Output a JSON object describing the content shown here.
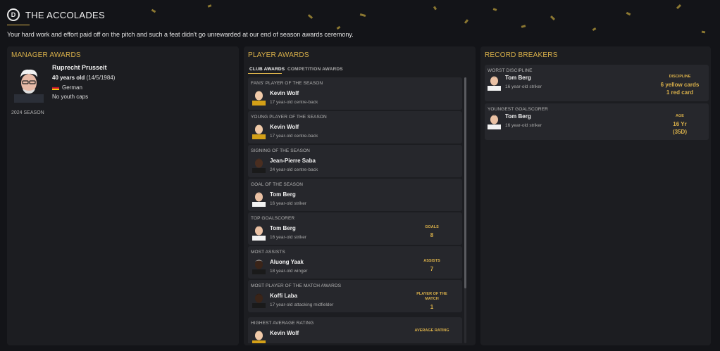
{
  "header": {
    "title": "THE ACCOLADES",
    "logo_letter": "D",
    "subtitle": "Your hard work and effort paid off on the pitch and such a feat didn't go unrewarded at our end of season awards ceremony."
  },
  "manager_panel": {
    "title": "MANAGER AWARDS",
    "name": "Ruprecht Prusseit",
    "age": "40 years old",
    "dob": "(14/5/1984)",
    "nationality": "German",
    "youth_caps": "No youth caps",
    "season": "2024 SEASON"
  },
  "player_panel": {
    "title": "PLAYER AWARDS",
    "tabs": [
      {
        "label": "CLUB AWARDS"
      },
      {
        "label": "COMPETITION AWARDS"
      }
    ],
    "awards": [
      {
        "category": "FANS' PLAYER OF THE SEASON",
        "player": "Kevin Wolf",
        "desc": "17 year-old centre-back",
        "stat_label": "",
        "stat_value": ""
      },
      {
        "category": "YOUNG PLAYER OF THE SEASON",
        "player": "Kevin Wolf",
        "desc": "17 year-old centre-back",
        "stat_label": "",
        "stat_value": ""
      },
      {
        "category": "SIGNING OF THE SEASON",
        "player": "Jean-Pierre Saba",
        "desc": "24 year-old centre-back",
        "stat_label": "",
        "stat_value": ""
      },
      {
        "category": "GOAL OF THE SEASON",
        "player": "Tom Berg",
        "desc": "16 year-old striker",
        "stat_label": "",
        "stat_value": ""
      },
      {
        "category": "TOP GOALSCORER",
        "player": "Tom Berg",
        "desc": "16 year-old striker",
        "stat_label": "GOALS",
        "stat_value": "8"
      },
      {
        "category": "MOST ASSISTS",
        "player": "Aluong Yaak",
        "desc": "18 year-old winger",
        "stat_label": "ASSISTS",
        "stat_value": "7"
      },
      {
        "category": "MOST PLAYER OF THE MATCH AWARDS",
        "player": "Koffi Laba",
        "desc": "17 year-old attacking midfielder",
        "stat_label": "PLAYER OF THE MATCH",
        "stat_value": "1"
      },
      {
        "category": "HIGHEST AVERAGE RATING",
        "player": "Kevin Wolf",
        "desc": "",
        "stat_label": "AVERAGE RATING",
        "stat_value": ""
      }
    ]
  },
  "record_panel": {
    "title": "RECORD BREAKERS",
    "records": [
      {
        "category": "WORST DISCIPLINE",
        "player": "Tom Berg",
        "desc": "16 year-old striker",
        "stat_label": "DISCIPLINE",
        "stat_line1": "6 yellow cards",
        "stat_line2": "1 red card"
      },
      {
        "category": "YOUNGEST GOALSCORER",
        "player": "Tom Berg",
        "desc": "16 year-old striker",
        "stat_label": "AGE",
        "stat_line1": "16 Yr",
        "stat_line2": "(35D)"
      }
    ]
  },
  "colors": {
    "background": "#131418",
    "panel": "#1c1d21",
    "card": "#26272c",
    "accent_gold": "#d9b04a"
  }
}
